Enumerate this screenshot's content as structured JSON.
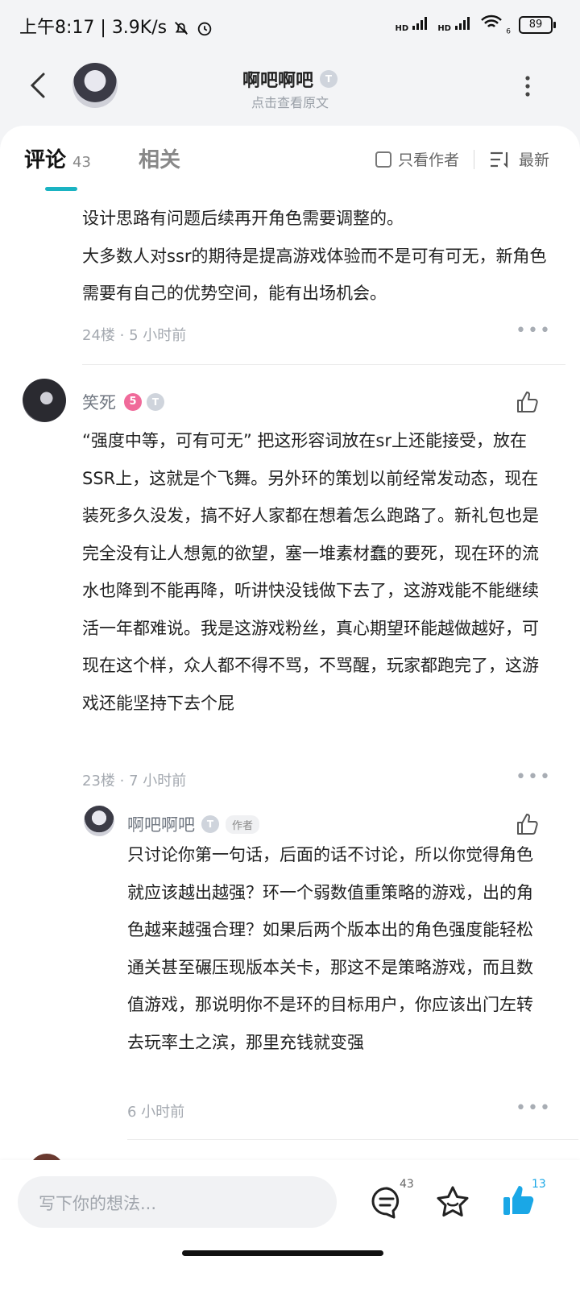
{
  "status_bar": {
    "time": "上午8:17",
    "speed": "3.9K/s",
    "network1": "HD",
    "network2": "HD",
    "wifi_label": "6",
    "battery": "89"
  },
  "header": {
    "author_name": "啊吧啊吧",
    "author_badge": "T",
    "subtitle": "点击查看原文"
  },
  "tabs": {
    "comments_label": "评论",
    "comments_count": "43",
    "related_label": "相关",
    "only_author_label": "只看作者",
    "sort_label": "最新"
  },
  "comments": [
    {
      "paragraphs": [
        "设计思路有问题后续再开角色需要调整的。",
        "大多数人对ssr的期待是提高游戏体验而不是可有可无，新角色需要有自己的优势空间，能有出场机会。"
      ],
      "floor": "24楼",
      "time": "5 小时前"
    },
    {
      "user": "笑死",
      "level_badge": "5",
      "user_badge": "T",
      "text": "“强度中等，可有可无” 把这形容词放在sr上还能接受，放在SSR上，这就是个飞舞。另外环的策划以前经常发动态，现在装死多久没发，搞不好人家都在想着怎么跑路了。新礼包也是完全没有让人想氪的欲望，塞一堆素材蠢的要死，现在环的流水也降到不能再降，听讲快没钱做下去了，这游戏能不能继续活一年都难说。我是这游戏粉丝，真心期望环能越做越好，可现在这个样，众人都不得不骂，不骂醒，玩家都跑完了，这游戏还能坚持下去个屁",
      "floor": "23楼",
      "time": "7 小时前"
    }
  ],
  "reply": {
    "user": "啊吧啊吧",
    "user_badge": "T",
    "author_tag": "作者",
    "text": "只讨论你第一句话，后面的话不讨论，所以你觉得角色就应该越出越强？环一个弱数值重策略的游戏，出的角色越来越强合理？如果后两个版本出的角色强度能轻松通关甚至碾压现版本关卡，那这不是策略游戏，而且数值游戏，那说明你不是环的目标用户，你应该出门左转去玩率土之滨，那里充钱就变强",
    "time": "6 小时前"
  },
  "bottom_bar": {
    "input_placeholder": "写下你的想法...",
    "comment_count": "43",
    "like_count": "13"
  },
  "colors": {
    "accent": "#1ab3c2",
    "like_blue": "#1aa7e6",
    "level_badge": "#f06a9a"
  },
  "icons": [
    "back-arrow-icon",
    "more-vertical-icon",
    "checkbox-icon",
    "sort-icon",
    "ellipsis-icon",
    "thumbs-up-icon",
    "comment-bubble-icon",
    "star-icon",
    "thumbs-up-filled-icon",
    "mute-bell-icon",
    "alarm-icon",
    "signal-icon",
    "wifi-icon",
    "battery-icon"
  ]
}
